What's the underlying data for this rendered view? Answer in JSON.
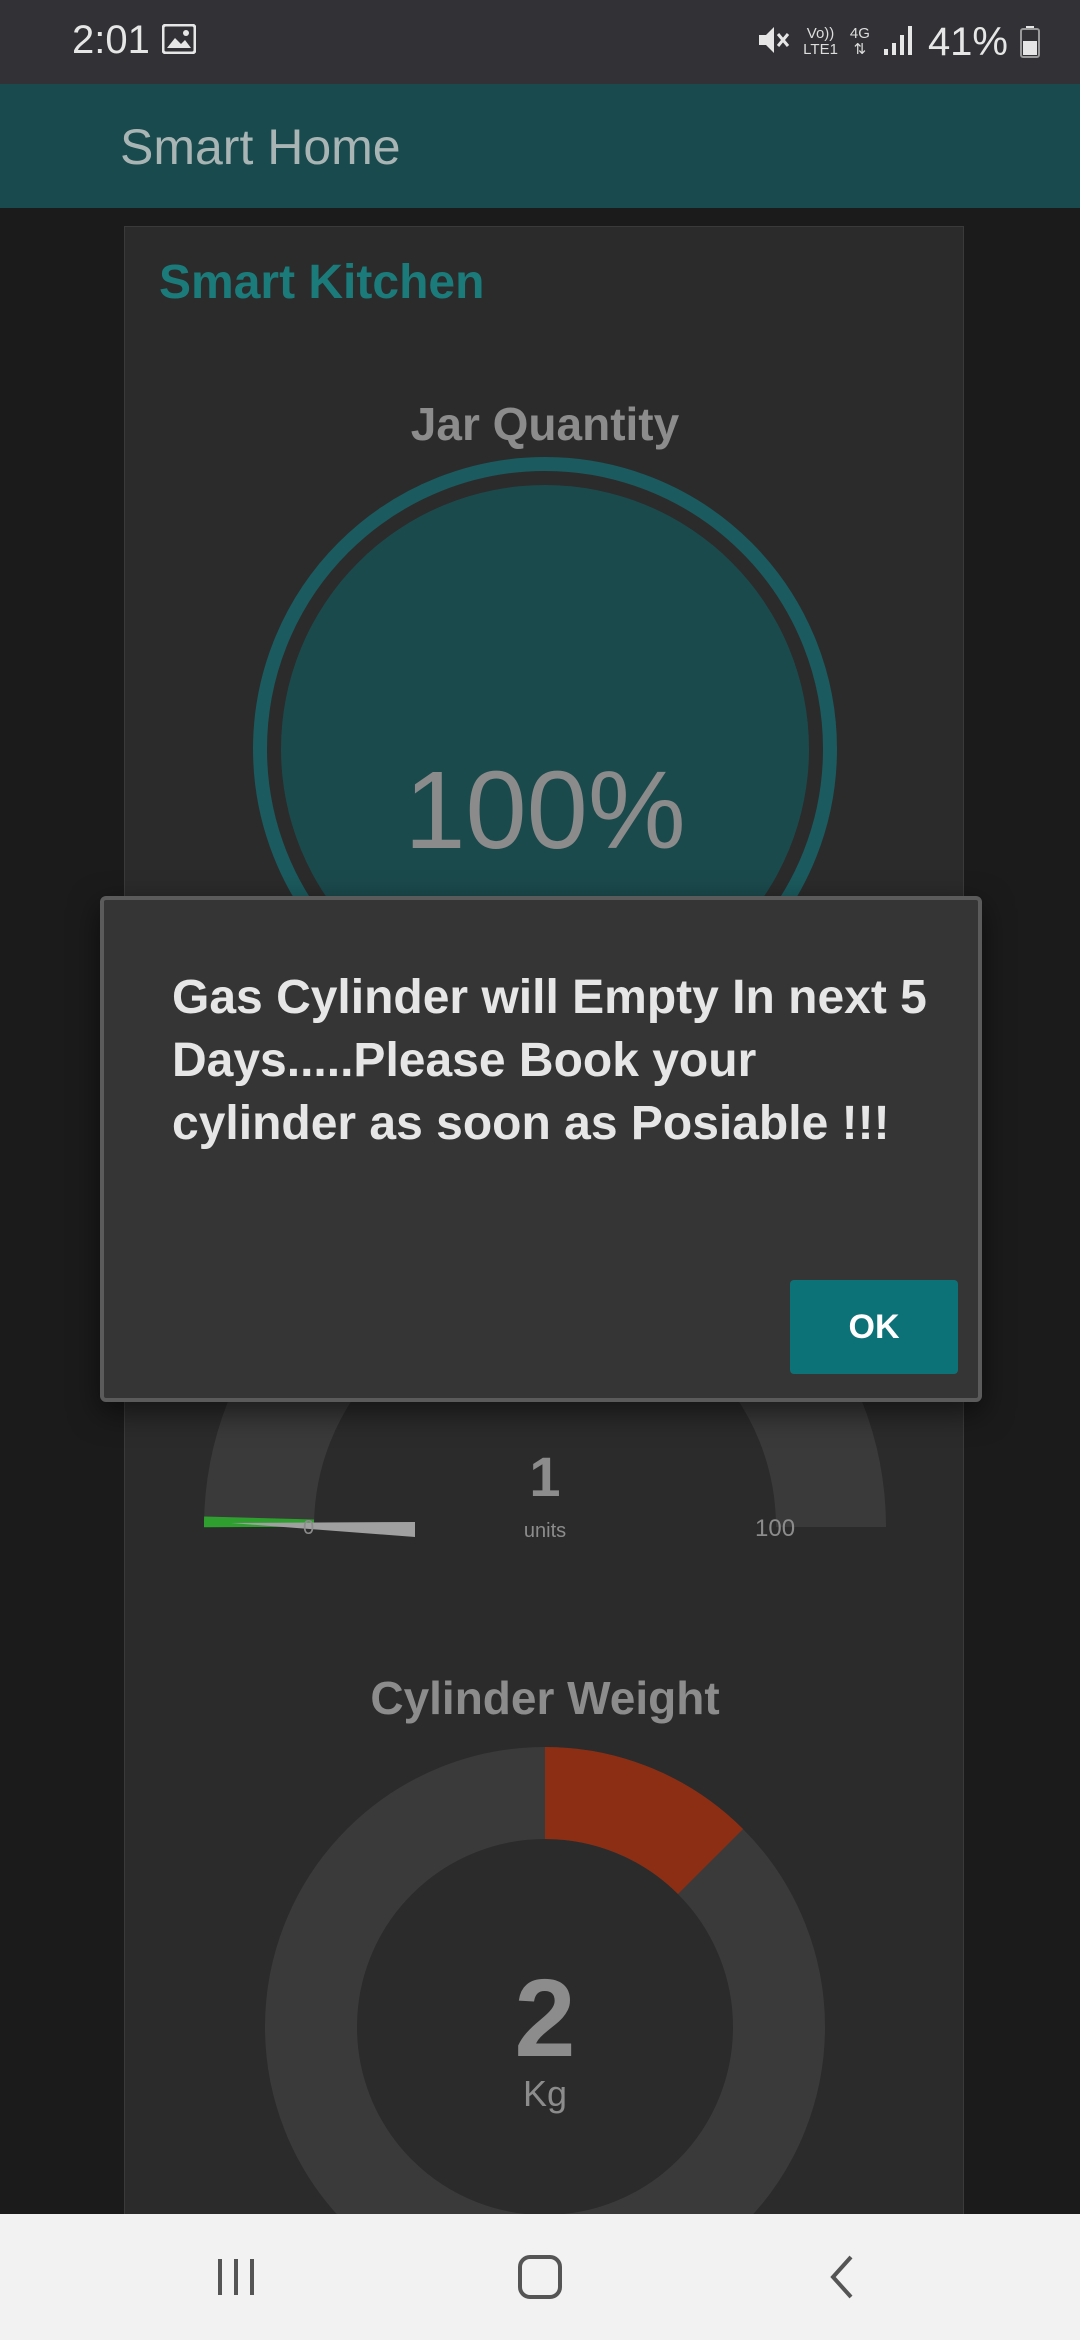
{
  "status_bar": {
    "time": "2:01",
    "network_top": "Vo))",
    "network_bottom": "LTE1",
    "network_type": "4G",
    "battery": "41%",
    "icons": [
      "gallery-icon",
      "mute-icon",
      "signal-icon",
      "battery-icon"
    ]
  },
  "app_bar": {
    "title": "Smart Home"
  },
  "card": {
    "title": "Smart Kitchen",
    "jar": {
      "heading": "Jar Quantity",
      "value": "100%",
      "fill_fraction": 1.0
    },
    "gauge": {
      "value": "1",
      "unit": "units",
      "min": "0",
      "max": "100",
      "level": 1,
      "range": [
        0,
        100
      ]
    },
    "weight": {
      "heading": "Cylinder Weight",
      "value": "2",
      "unit": "Kg",
      "filled_fraction": 0.125
    }
  },
  "dialog": {
    "message": "Gas Cylinder will Empty In next 5 Days.....Please Book your cylinder as soon as Posiable !!!",
    "ok_label": "OK"
  },
  "nav_bar": {
    "icons": [
      "recent-apps-icon",
      "home-icon",
      "back-icon"
    ]
  },
  "colors": {
    "accent": "#0d7277",
    "app_bar": "#194a4d",
    "gauge_fill": "#2fa02f",
    "weight_fill": "#8c2e14"
  }
}
